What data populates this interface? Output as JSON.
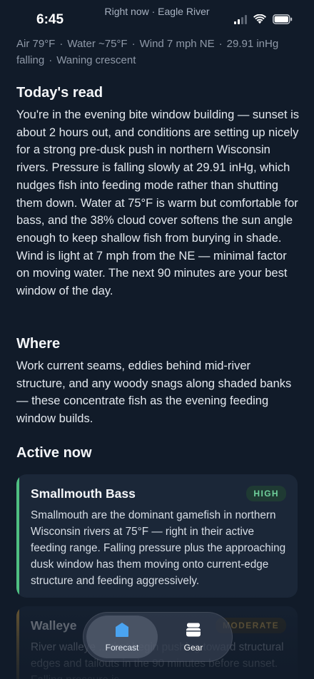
{
  "status_bar": {
    "time": "6:45",
    "subtitle": "Right now · Eagle River",
    "icons": [
      "cellular-signal-icon",
      "wifi-icon",
      "battery-icon"
    ]
  },
  "conditions": {
    "air": "Air 79°F",
    "water": "Water ~75°F",
    "wind": "Wind 7 mph NE",
    "pressure": "29.91 inHg",
    "pressure_trend": "falling",
    "moon": "Waning crescent",
    "separator": "·"
  },
  "todays_read": {
    "title": "Today's read",
    "body": "You're in the evening bite window building — sunset is about 2 hours out, and conditions are setting up nicely for a strong pre-dusk push in northern Wisconsin rivers. Pressure is falling slowly at 29.91 inHg, which nudges fish into feeding mode rather than shutting them down. Water at 75°F is warm but comfortable for bass, and the 38% cloud cover softens the sun angle enough to keep shallow fish from burying in shade. Wind is light at 7 mph from the NE — minimal factor on moving water. The next 90 minutes are your best window of the day."
  },
  "where": {
    "title": "Where",
    "body": "Work current seams, eddies behind mid-river structure, and any woody snags along shaded banks — these concentrate fish as the evening feeding window builds."
  },
  "active_now": {
    "title": "Active now",
    "cards": [
      {
        "name": "Smallmouth Bass",
        "badge": "HIGH",
        "accent_color": "#4fbf82",
        "badge_bg": "#1f3a33",
        "badge_color": "#6fd09b",
        "body": "Smallmouth are the dominant gamefish in northern Wisconsin rivers at 75°F — right in their active feeding range. Falling pressure plus the approaching dusk window has them moving onto current-edge structure and feeding aggressively."
      },
      {
        "name": "Walleye",
        "badge": "MODERATE",
        "accent_color": "#c99a3e",
        "badge_bg": "#3a3322",
        "badge_color": "#d8a94c",
        "body": "River walleye ... that begin pushing toward structural edges and tailouts in the 90 minutes before sunset. Falling pressure is"
      }
    ]
  },
  "tab_bar": {
    "tabs": [
      {
        "label": "Forecast",
        "icon": "forecast-pin-icon",
        "active": true,
        "icon_color": "#4aa3f0"
      },
      {
        "label": "Gear",
        "icon": "gear-box-icon",
        "active": false,
        "icon_color": "#ffffff"
      }
    ]
  }
}
